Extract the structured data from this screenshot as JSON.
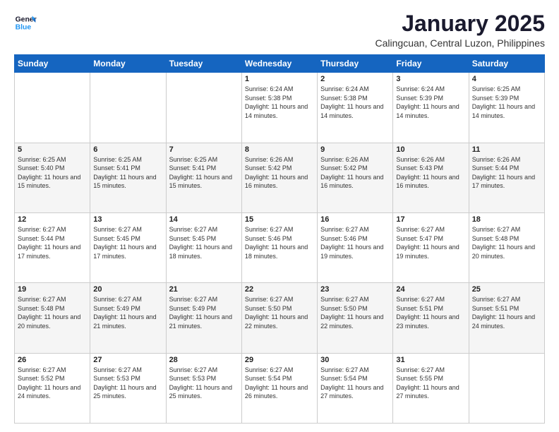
{
  "logo": {
    "line1": "General",
    "line2": "Blue"
  },
  "title": "January 2025",
  "subtitle": "Calingcuan, Central Luzon, Philippines",
  "days_of_week": [
    "Sunday",
    "Monday",
    "Tuesday",
    "Wednesday",
    "Thursday",
    "Friday",
    "Saturday"
  ],
  "weeks": [
    [
      {
        "day": "",
        "info": ""
      },
      {
        "day": "",
        "info": ""
      },
      {
        "day": "",
        "info": ""
      },
      {
        "day": "1",
        "info": "Sunrise: 6:24 AM\nSunset: 5:38 PM\nDaylight: 11 hours and 14 minutes."
      },
      {
        "day": "2",
        "info": "Sunrise: 6:24 AM\nSunset: 5:38 PM\nDaylight: 11 hours and 14 minutes."
      },
      {
        "day": "3",
        "info": "Sunrise: 6:24 AM\nSunset: 5:39 PM\nDaylight: 11 hours and 14 minutes."
      },
      {
        "day": "4",
        "info": "Sunrise: 6:25 AM\nSunset: 5:39 PM\nDaylight: 11 hours and 14 minutes."
      }
    ],
    [
      {
        "day": "5",
        "info": "Sunrise: 6:25 AM\nSunset: 5:40 PM\nDaylight: 11 hours and 15 minutes."
      },
      {
        "day": "6",
        "info": "Sunrise: 6:25 AM\nSunset: 5:41 PM\nDaylight: 11 hours and 15 minutes."
      },
      {
        "day": "7",
        "info": "Sunrise: 6:25 AM\nSunset: 5:41 PM\nDaylight: 11 hours and 15 minutes."
      },
      {
        "day": "8",
        "info": "Sunrise: 6:26 AM\nSunset: 5:42 PM\nDaylight: 11 hours and 16 minutes."
      },
      {
        "day": "9",
        "info": "Sunrise: 6:26 AM\nSunset: 5:42 PM\nDaylight: 11 hours and 16 minutes."
      },
      {
        "day": "10",
        "info": "Sunrise: 6:26 AM\nSunset: 5:43 PM\nDaylight: 11 hours and 16 minutes."
      },
      {
        "day": "11",
        "info": "Sunrise: 6:26 AM\nSunset: 5:44 PM\nDaylight: 11 hours and 17 minutes."
      }
    ],
    [
      {
        "day": "12",
        "info": "Sunrise: 6:27 AM\nSunset: 5:44 PM\nDaylight: 11 hours and 17 minutes."
      },
      {
        "day": "13",
        "info": "Sunrise: 6:27 AM\nSunset: 5:45 PM\nDaylight: 11 hours and 17 minutes."
      },
      {
        "day": "14",
        "info": "Sunrise: 6:27 AM\nSunset: 5:45 PM\nDaylight: 11 hours and 18 minutes."
      },
      {
        "day": "15",
        "info": "Sunrise: 6:27 AM\nSunset: 5:46 PM\nDaylight: 11 hours and 18 minutes."
      },
      {
        "day": "16",
        "info": "Sunrise: 6:27 AM\nSunset: 5:46 PM\nDaylight: 11 hours and 19 minutes."
      },
      {
        "day": "17",
        "info": "Sunrise: 6:27 AM\nSunset: 5:47 PM\nDaylight: 11 hours and 19 minutes."
      },
      {
        "day": "18",
        "info": "Sunrise: 6:27 AM\nSunset: 5:48 PM\nDaylight: 11 hours and 20 minutes."
      }
    ],
    [
      {
        "day": "19",
        "info": "Sunrise: 6:27 AM\nSunset: 5:48 PM\nDaylight: 11 hours and 20 minutes."
      },
      {
        "day": "20",
        "info": "Sunrise: 6:27 AM\nSunset: 5:49 PM\nDaylight: 11 hours and 21 minutes."
      },
      {
        "day": "21",
        "info": "Sunrise: 6:27 AM\nSunset: 5:49 PM\nDaylight: 11 hours and 21 minutes."
      },
      {
        "day": "22",
        "info": "Sunrise: 6:27 AM\nSunset: 5:50 PM\nDaylight: 11 hours and 22 minutes."
      },
      {
        "day": "23",
        "info": "Sunrise: 6:27 AM\nSunset: 5:50 PM\nDaylight: 11 hours and 22 minutes."
      },
      {
        "day": "24",
        "info": "Sunrise: 6:27 AM\nSunset: 5:51 PM\nDaylight: 11 hours and 23 minutes."
      },
      {
        "day": "25",
        "info": "Sunrise: 6:27 AM\nSunset: 5:51 PM\nDaylight: 11 hours and 24 minutes."
      }
    ],
    [
      {
        "day": "26",
        "info": "Sunrise: 6:27 AM\nSunset: 5:52 PM\nDaylight: 11 hours and 24 minutes."
      },
      {
        "day": "27",
        "info": "Sunrise: 6:27 AM\nSunset: 5:53 PM\nDaylight: 11 hours and 25 minutes."
      },
      {
        "day": "28",
        "info": "Sunrise: 6:27 AM\nSunset: 5:53 PM\nDaylight: 11 hours and 25 minutes."
      },
      {
        "day": "29",
        "info": "Sunrise: 6:27 AM\nSunset: 5:54 PM\nDaylight: 11 hours and 26 minutes."
      },
      {
        "day": "30",
        "info": "Sunrise: 6:27 AM\nSunset: 5:54 PM\nDaylight: 11 hours and 27 minutes."
      },
      {
        "day": "31",
        "info": "Sunrise: 6:27 AM\nSunset: 5:55 PM\nDaylight: 11 hours and 27 minutes."
      },
      {
        "day": "",
        "info": ""
      }
    ]
  ]
}
